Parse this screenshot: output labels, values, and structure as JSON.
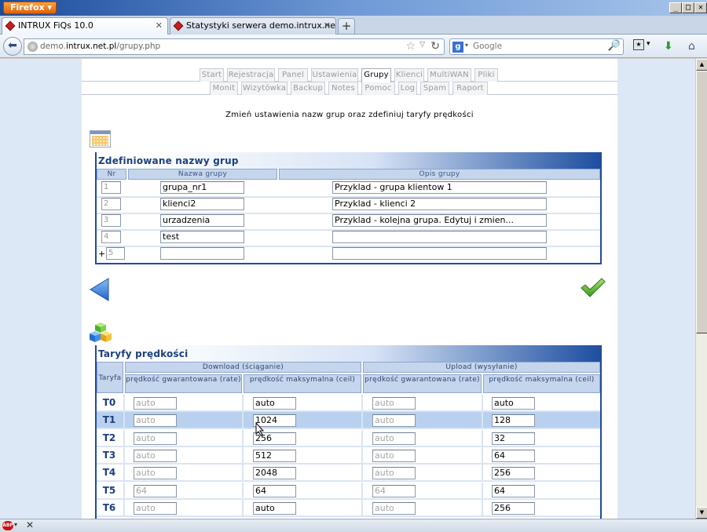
{
  "window": {
    "app_button": "Firefox",
    "controls": [
      "_",
      "□",
      "✕"
    ]
  },
  "tabs": [
    {
      "title": "INTRUX FiQs 10.0",
      "active": true
    },
    {
      "title": "Statystyki serwera demo.intrux.net.pl",
      "active": false
    }
  ],
  "navbar": {
    "url_prefix": "demo.",
    "url_domain": "intrux.net.pl",
    "url_path": "/grupy.php",
    "search_placeholder": "Google",
    "search_engine_letter": "g"
  },
  "menu": {
    "row1": [
      {
        "label": "Start",
        "active": false
      },
      {
        "label": "Rejestracja",
        "active": false
      },
      {
        "label": "Panel",
        "active": false
      },
      {
        "label": "Ustawienia",
        "active": false
      },
      {
        "label": "Grupy",
        "active": true
      },
      {
        "label": "Klienci",
        "active": false
      },
      {
        "label": "MultiWAN",
        "active": false
      },
      {
        "label": "Pliki",
        "active": false
      }
    ],
    "row2": [
      {
        "label": "Monit"
      },
      {
        "label": "Wizytówka"
      },
      {
        "label": "Backup"
      },
      {
        "label": "Notes"
      },
      {
        "label": "Pomoc"
      },
      {
        "label": "Log"
      },
      {
        "label": "Spam"
      },
      {
        "label": "Raport"
      }
    ]
  },
  "subtitle": "Zmień ustawienia nazw grup oraz zdefiniuj taryfy prędkości",
  "groups": {
    "title": "Zdefiniowane nazwy grup",
    "headers": {
      "nr": "Nr",
      "name": "Nazwa grupy",
      "desc": "Opis grupy"
    },
    "rows": [
      {
        "nr": "1",
        "name": "grupa_nr1",
        "desc": "Przyklad - grupa klientow 1"
      },
      {
        "nr": "2",
        "name": "klienci2",
        "desc": "Przyklad - klienci 2"
      },
      {
        "nr": "3",
        "name": "urzadzenia",
        "desc": "Przyklad - kolejna grupa. Edytuj i zmien..."
      },
      {
        "nr": "4",
        "name": "test",
        "desc": ""
      }
    ],
    "new_row": {
      "plus": "+",
      "nr": "5",
      "name": "",
      "desc": ""
    }
  },
  "speeds": {
    "title": "Taryfy prędkości",
    "headers": {
      "tariff": "Taryfa",
      "download": "Download (ściąganie)",
      "upload": "Upload (wysyłanie)",
      "rate": "prędkość gwarantowana (rate)",
      "ceil": "prędkość maksymalna (ceil)"
    },
    "rows": [
      {
        "name": "T0",
        "d_rate": "auto",
        "d_ceil": "auto",
        "u_rate": "auto",
        "u_ceil": "auto",
        "highlight": false
      },
      {
        "name": "T1",
        "d_rate": "auto",
        "d_ceil": "1024",
        "u_rate": "auto",
        "u_ceil": "128",
        "highlight": true
      },
      {
        "name": "T2",
        "d_rate": "auto",
        "d_ceil": "256",
        "u_rate": "auto",
        "u_ceil": "32",
        "highlight": false
      },
      {
        "name": "T3",
        "d_rate": "auto",
        "d_ceil": "512",
        "u_rate": "auto",
        "u_ceil": "64",
        "highlight": false
      },
      {
        "name": "T4",
        "d_rate": "auto",
        "d_ceil": "2048",
        "u_rate": "auto",
        "u_ceil": "256",
        "highlight": false
      },
      {
        "name": "T5",
        "d_rate": "64",
        "d_ceil": "64",
        "u_rate": "64",
        "u_ceil": "64",
        "highlight": false
      },
      {
        "name": "T6",
        "d_rate": "auto",
        "d_ceil": "auto",
        "u_rate": "auto",
        "u_ceil": "256",
        "highlight": false
      }
    ]
  },
  "icons": {
    "back": "back-arrow-icon",
    "ok": "checkmark-icon",
    "calendar": "calendar-icon",
    "cubes": "cubes-icon"
  },
  "colors": {
    "accent": "#1c3f7c",
    "panel_border": "#234b9b",
    "highlight_row": "#b9d0ef",
    "header_cell": "#c5d5ec"
  }
}
